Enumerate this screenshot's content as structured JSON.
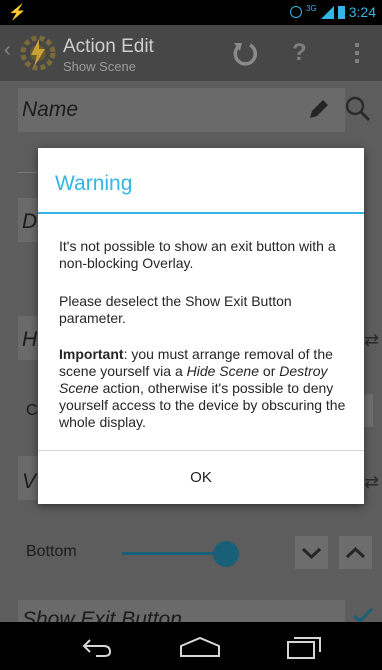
{
  "status_bar": {
    "network": "3G",
    "time": "3:24"
  },
  "action_bar": {
    "title": "Action Edit",
    "subtitle": "Show Scene",
    "help": "?",
    "back_icon": "chevron-left-icon",
    "app_icon": "tasker-icon"
  },
  "background": {
    "name_label": "Name",
    "d_label": "D",
    "h_label": "H",
    "c_label": "C",
    "v_label": "V",
    "bottom_label": "Bottom",
    "show_exit_label": "Show Exit Button",
    "slider_value": 0.8,
    "show_exit_checked": true
  },
  "dialog": {
    "title": "Warning",
    "paragraph1": "It's not possible to show an exit button with a non-blocking Overlay.",
    "paragraph2": "Please deselect the Show Exit Button parameter.",
    "important_label": "Important",
    "important_part1": ": you must arrange removal of the scene yourself via a ",
    "hide_scene": "Hide Scene",
    "or_text": " or ",
    "destroy_scene": "Destroy Scene",
    "important_part2": " action, otherwise it's possible to deny yourself access to the device by obscuring the whole display.",
    "ok_label": "OK"
  },
  "colors": {
    "accent": "#33b5e5",
    "dim_background": "#5d5d5d"
  }
}
